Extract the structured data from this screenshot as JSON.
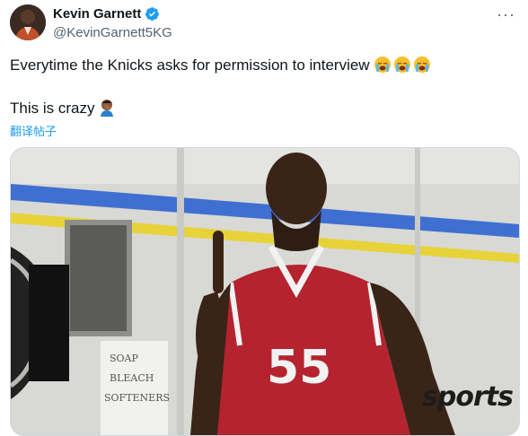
{
  "author": {
    "display_name": "Kevin Garnett",
    "handle": "@KevinGarnett5KG",
    "verified_icon": "verified-badge-icon",
    "avatar": "profile-avatar"
  },
  "post": {
    "line1": "Everytime the Knicks asks for permission to interview",
    "line1_emoji": [
      "loudly-crying-face",
      "loudly-crying-face",
      "loudly-crying-face"
    ],
    "line2": "This is crazy",
    "line2_emoji": "person-facepalming",
    "translate_label": "翻译帖子"
  },
  "media": {
    "jersey_number": "55",
    "sign_lines": [
      "SOAP",
      "BLEACH",
      "SOFTENERS"
    ],
    "watermark": "sports"
  },
  "colors": {
    "link": "#1d9bf0",
    "verified": "#1d9bf0",
    "secondary_text": "#536471",
    "jersey": "#b5232f"
  }
}
